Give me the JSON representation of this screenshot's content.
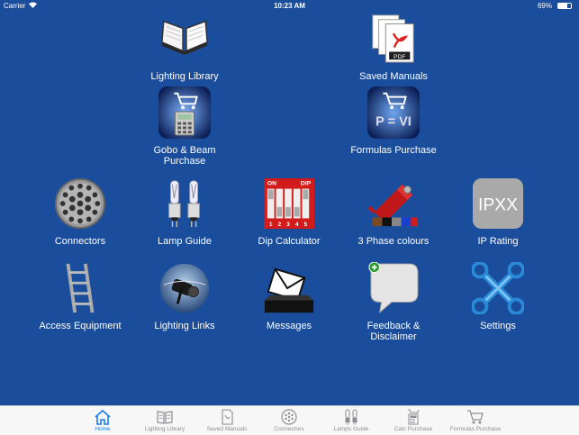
{
  "status_bar": {
    "carrier": "Carrier",
    "time": "10:23 AM",
    "battery": "69%"
  },
  "grid": {
    "items": [
      {
        "label": "Lighting Library",
        "icon": "open-book-icon"
      },
      {
        "label": "Saved Manuals",
        "icon": "pdf-documents-icon"
      },
      {
        "label": "Gobo & Beam Purchase",
        "icon": "calculator-cart-icon"
      },
      {
        "label": "Formulas Purchase",
        "icon": "formula-cart-icon"
      },
      {
        "label": "Connectors",
        "icon": "connector-pins-icon"
      },
      {
        "label": "Lamp Guide",
        "icon": "lamp-bulbs-icon"
      },
      {
        "label": "Dip Calculator",
        "icon": "dip-switch-icon"
      },
      {
        "label": "3 Phase colours",
        "icon": "three-phase-plug-icon"
      },
      {
        "label": "IP Rating",
        "icon": "ipxx-icon"
      },
      {
        "label": "Access Equipment",
        "icon": "ladder-icon"
      },
      {
        "label": "Lighting Links",
        "icon": "spotlight-globe-icon"
      },
      {
        "label": "Messages",
        "icon": "envelope-ballot-icon"
      },
      {
        "label": "Feedback & Disclaimer",
        "icon": "speech-bubble-icon"
      },
      {
        "label": "Settings",
        "icon": "wrench-settings-icon"
      }
    ],
    "ipxx_text": "IPXX",
    "pdf_text": "PDF",
    "formula_text": "P = VI",
    "dip_on": "ON",
    "dip_dip": "DIP",
    "dip_numbers": [
      "1",
      "2",
      "3",
      "4",
      "5"
    ]
  },
  "tab_bar": {
    "tabs": [
      {
        "label": "Home",
        "icon": "home-icon",
        "active": true
      },
      {
        "label": "Lighting Library",
        "icon": "book-icon",
        "active": false
      },
      {
        "label": "Saved Manuals",
        "icon": "pdf-icon",
        "active": false
      },
      {
        "label": "Connectors",
        "icon": "connector-icon",
        "active": false
      },
      {
        "label": "Lamps Guide",
        "icon": "lamp-icon",
        "active": false
      },
      {
        "label": "Calc Purchase",
        "icon": "calc-cart-icon",
        "active": false
      },
      {
        "label": "Formulas Purchase",
        "icon": "cart-icon",
        "active": false
      }
    ]
  },
  "colors": {
    "background": "#1a4d9c",
    "tab_active": "#1a7cf0",
    "tab_inactive": "#8e8e93"
  }
}
